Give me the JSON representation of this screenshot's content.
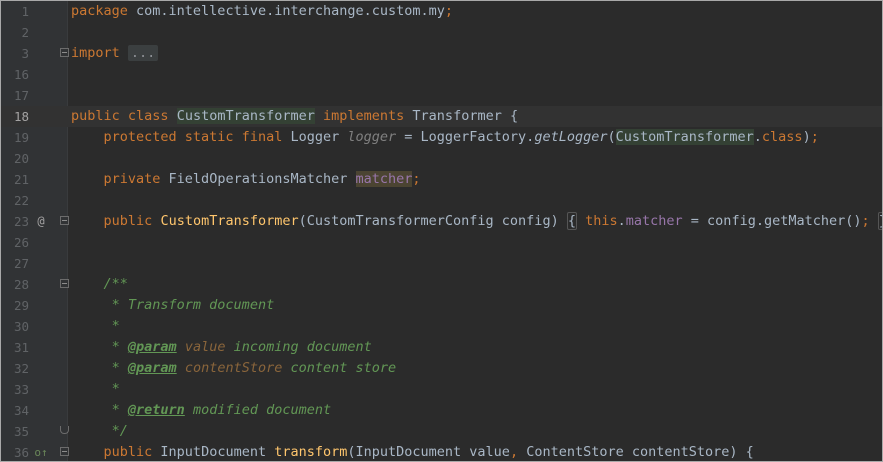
{
  "lines": [
    {
      "n": "1"
    },
    {
      "n": "2"
    },
    {
      "n": "3"
    },
    {
      "n": "16"
    },
    {
      "n": "17"
    },
    {
      "n": "18"
    },
    {
      "n": "19"
    },
    {
      "n": "20"
    },
    {
      "n": "21"
    },
    {
      "n": "22"
    },
    {
      "n": "23",
      "marker": "@"
    },
    {
      "n": "26"
    },
    {
      "n": "27"
    },
    {
      "n": "28"
    },
    {
      "n": "29"
    },
    {
      "n": "30"
    },
    {
      "n": "31"
    },
    {
      "n": "32"
    },
    {
      "n": "33"
    },
    {
      "n": "34"
    },
    {
      "n": "35"
    },
    {
      "n": "36",
      "marker": "o↑"
    }
  ],
  "code": {
    "l1": {
      "kw": "package",
      "rest": " com.intellective.interchange.custom.my",
      "semi": ";"
    },
    "l3": {
      "kw": "import",
      "folded": "..."
    },
    "l18": {
      "kw1": "public",
      "kw2": "class",
      "cls": "CustomTransformer",
      "kw3": "implements",
      "iface": " Transformer {"
    },
    "l19": {
      "kw": "protected static final",
      "type": " Logger ",
      "field": "logger",
      "eq": " = LoggerFactory.",
      "method": "getLogger",
      "open": "(",
      "cls": "CustomTransformer",
      "dot": ".",
      "classkw": "class",
      "close": ")",
      "semi": ";"
    },
    "l21": {
      "kw": "private",
      "type": " FieldOperationsMatcher ",
      "field": "matcher",
      "semi": ";"
    },
    "l23": {
      "kw": "public",
      "ctor": "CustomTransformer",
      "params": "(CustomTransformerConfig config) ",
      "lbrace": "{",
      "this": "this",
      "dot": ".",
      "field": "matcher",
      "assign": " = config.getMatcher()",
      "semi": ";",
      "rbrace": "}"
    },
    "l28": {
      "doc": "/**"
    },
    "l29": {
      "doc": " * Transform document"
    },
    "l30": {
      "doc": " *"
    },
    "l31": {
      "star": " * ",
      "tag": "@param",
      "pname": "value",
      "desc": " incoming document"
    },
    "l32": {
      "star": " * ",
      "tag": "@param",
      "pname": "contentStore",
      "desc": " content store"
    },
    "l33": {
      "doc": " *"
    },
    "l34": {
      "star": " * ",
      "tag": "@return",
      "desc": " modified document"
    },
    "l35": {
      "doc": " */"
    },
    "l36": {
      "kw": "public",
      "type": " InputDocument ",
      "method": "transform",
      "p1": "(InputDocument value",
      "comma": ",",
      "p2": " ContentStore contentStore) {"
    }
  }
}
